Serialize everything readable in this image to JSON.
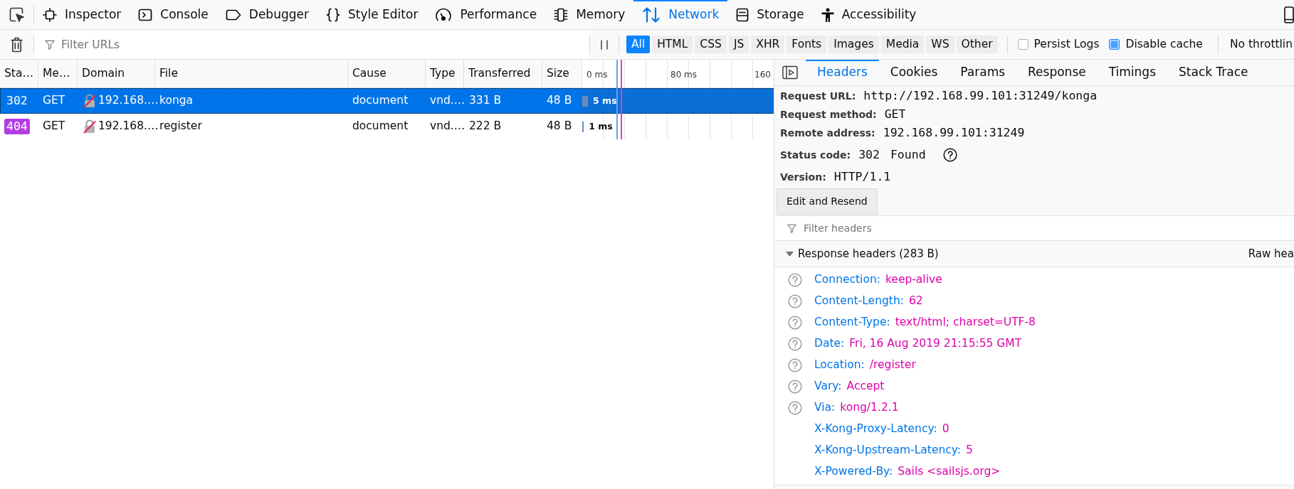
{
  "toolbox": {
    "tabs": [
      {
        "label": "Inspector",
        "selected": false
      },
      {
        "label": "Console",
        "selected": false
      },
      {
        "label": "Debugger",
        "selected": false
      },
      {
        "label": "Style Editor",
        "selected": false
      },
      {
        "label": "Performance",
        "selected": false
      },
      {
        "label": "Memory",
        "selected": false
      },
      {
        "label": "Network",
        "selected": true
      },
      {
        "label": "Storage",
        "selected": false
      },
      {
        "label": "Accessibility",
        "selected": false
      }
    ]
  },
  "network_toolbar": {
    "url_filter": {
      "placeholder": "Filter URLs"
    },
    "type_filters": [
      {
        "label": "All",
        "selected": true
      },
      {
        "label": "HTML",
        "selected": false
      },
      {
        "label": "CSS",
        "selected": false
      },
      {
        "label": "JS",
        "selected": false
      },
      {
        "label": "XHR",
        "selected": false
      },
      {
        "label": "Fonts",
        "selected": false
      },
      {
        "label": "Images",
        "selected": false
      },
      {
        "label": "Media",
        "selected": false
      },
      {
        "label": "WS",
        "selected": false
      },
      {
        "label": "Other",
        "selected": false
      }
    ],
    "options": [
      {
        "label": "Persist Logs",
        "checked": false
      },
      {
        "label": "Disable cache",
        "checked": true
      }
    ],
    "throttling": "No throttlin"
  },
  "requests": {
    "columns": [
      "Sta…",
      "Me…",
      "Domain",
      "File",
      "Cause",
      "Type",
      "Transferred",
      "Size"
    ],
    "waterfall_ticks": [
      "0 ms",
      "80 ms",
      "160"
    ],
    "rows": [
      {
        "selected": true,
        "status": {
          "code": "302"
        },
        "method": "GET",
        "domain": "192.168.…",
        "file": "konga",
        "cause": "document",
        "type": "vnd.…",
        "transferred": "331 B",
        "size": "48 B",
        "timing": {
          "label": "5 ms",
          "level": 0.03
        }
      },
      {
        "selected": false,
        "status": {
          "code": "404",
          "color": "#b23ee3"
        },
        "method": "GET",
        "domain": "192.168.…",
        "file": "register",
        "cause": "document",
        "type": "vnd.…",
        "transferred": "222 B",
        "size": "48 B",
        "timing": {
          "label": "1 ms",
          "level": 0.008
        }
      }
    ]
  },
  "details": {
    "tabs": [
      {
        "label": "Headers",
        "selected": true
      },
      {
        "label": "Cookies",
        "selected": false
      },
      {
        "label": "Params",
        "selected": false
      },
      {
        "label": "Response",
        "selected": false
      },
      {
        "label": "Timings",
        "selected": false
      },
      {
        "label": "Stack Trace",
        "selected": false
      }
    ],
    "request_info": [
      {
        "label": "Request URL:",
        "value": "http://192.168.99.101:31249/konga"
      },
      {
        "label": "Request method:",
        "value": "GET"
      },
      {
        "label": "Remote address:",
        "value": "192.168.99.101:31249"
      }
    ],
    "status": {
      "label": "Status code:",
      "code": "302",
      "text": "Found"
    },
    "version": {
      "label": "Version:",
      "value": "HTTP/1.1"
    },
    "edit_button": "Edit and Resend",
    "header_filter": {
      "placeholder": "Filter headers"
    },
    "response_headers": {
      "title": "Response headers (283 B)",
      "expanded": true,
      "raw_toggle": "Raw hea",
      "headers": [
        {
          "name": "Connection:",
          "value": "keep-alive",
          "has_help": true
        },
        {
          "name": "Content-Length:",
          "value": "62",
          "has_help": true
        },
        {
          "name": "Content-Type:",
          "value": "text/html; charset=UTF-8",
          "has_help": true
        },
        {
          "name": "Date:",
          "value": "Fri, 16 Aug 2019 21:15:55 GMT",
          "has_help": true
        },
        {
          "name": "Location:",
          "value": "/register",
          "has_help": true
        },
        {
          "name": "Vary:",
          "value": "Accept",
          "has_help": true
        },
        {
          "name": "Via:",
          "value": "kong/1.2.1",
          "has_help": true
        },
        {
          "name": "X-Kong-Proxy-Latency:",
          "value": "0",
          "has_help": false
        },
        {
          "name": "X-Kong-Upstream-Latency:",
          "value": "5",
          "has_help": false
        },
        {
          "name": "X-Powered-By:",
          "value": "Sails <sailsjs.org>",
          "has_help": false
        }
      ]
    }
  }
}
